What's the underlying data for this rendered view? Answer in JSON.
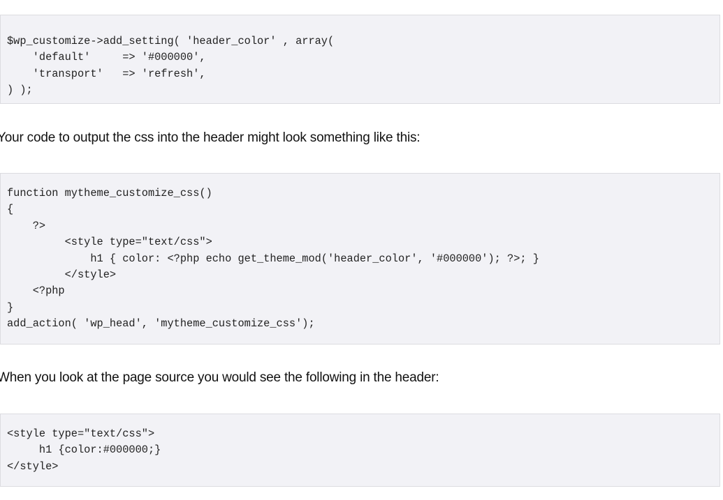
{
  "blocks": [
    {
      "type": "code",
      "text": "$wp_customize->add_setting( 'header_color' , array(\n    'default'     => '#000000',\n    'transport'   => 'refresh',\n) );"
    },
    {
      "type": "paragraph",
      "text": "Your code to output the css into the header might look something like this:"
    },
    {
      "type": "code",
      "text": "function mytheme_customize_css()\n{\n    ?>\n         <style type=\"text/css\">\n             h1 { color: <?php echo get_theme_mod('header_color', '#000000'); ?>; }\n         </style>\n    <?php\n}\nadd_action( 'wp_head', 'mytheme_customize_css');"
    },
    {
      "type": "paragraph",
      "text": "When you look at the page source you would see the following in the header:"
    },
    {
      "type": "code",
      "text": "<style type=\"text/css\">\n     h1 {color:#000000;}\n</style>"
    }
  ]
}
